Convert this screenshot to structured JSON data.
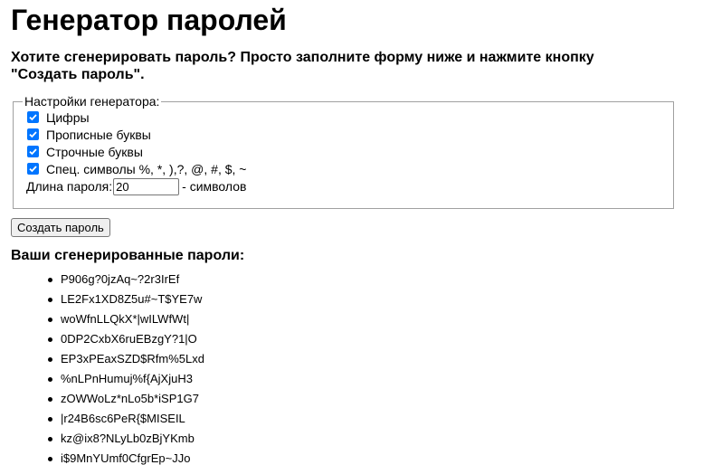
{
  "page": {
    "title": "Генератор паролей",
    "subtitle": "Хотите сгенерировать пароль? Просто заполните форму ниже и нажмите кнопку \"Создать пароль\"."
  },
  "settings": {
    "legend": "Настройки генератора:",
    "options": [
      {
        "label": "Цифры",
        "checked": true
      },
      {
        "label": "Прописные буквы",
        "checked": true
      },
      {
        "label": "Строчные буквы",
        "checked": true
      },
      {
        "label": "Спец. символы %, *, ),?, @, #, $, ~",
        "checked": true
      }
    ],
    "length_label": "Длина пароля:",
    "length_value": "20",
    "length_suffix": "- символов"
  },
  "actions": {
    "generate_label": "Создать пароль"
  },
  "results": {
    "heading": "Ваши сгенерированные пароли:",
    "passwords": [
      "P906g?0jzAq~?2r3IrEf",
      "LE2Fx1XD8Z5u#~T$YE7w",
      "woWfnLLQkX*|wILWfWt|",
      "0DP2CxbX6ruEBzgY?1|O",
      "EP3xPEaxSZD$Rfm%5Lxd",
      "%nLPnHumuj%f{AjXjuH3",
      "zOWWoLz*nLo5b*iSP1G7",
      "|r24B6sc6PeR{$MISEIL",
      "kz@ix8?NLyLb0zBjYKmb",
      "i$9MnYUmf0CfgrEp~JJo"
    ]
  },
  "colors": {
    "checkbox_accent": "#0075ff",
    "button_bg": "#efefef",
    "fieldset_border": "#a0a0a0"
  }
}
